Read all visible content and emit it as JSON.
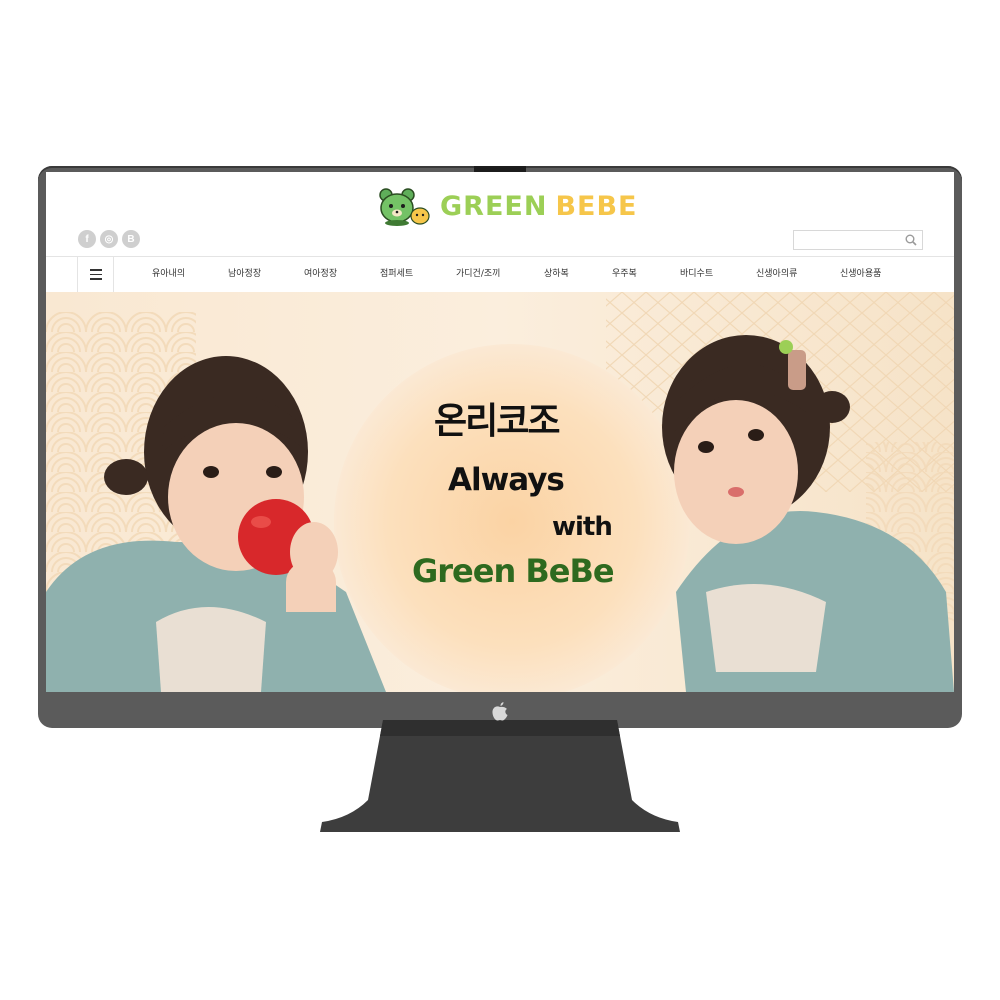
{
  "header": {
    "logo_word_1": "GREEN",
    "logo_word_2": "BEBE"
  },
  "social": [
    {
      "icon": "facebook-icon",
      "glyph": "f"
    },
    {
      "icon": "instagram-icon",
      "glyph": "◎"
    },
    {
      "icon": "blog-icon",
      "glyph": "B"
    }
  ],
  "search": {
    "placeholder": "",
    "icon": "search-icon"
  },
  "nav": {
    "menu_icon": "hamburger-icon",
    "items": [
      {
        "label": "유아내의"
      },
      {
        "label": "남아정장"
      },
      {
        "label": "여아정장"
      },
      {
        "label": "점퍼세트"
      },
      {
        "label": "가디건/조끼"
      },
      {
        "label": "상하복"
      },
      {
        "label": "우주복"
      },
      {
        "label": "바디수트"
      },
      {
        "label": "신생아의류"
      },
      {
        "label": "신생아용품"
      }
    ]
  },
  "hero": {
    "headline_korean": "온리코조",
    "line_1": "Always",
    "line_2": "with",
    "line_3": "Green BeBe"
  },
  "colors": {
    "logo_green": "#9ccf56",
    "logo_yellow": "#f6c64a",
    "brand_dark_green": "#2e6a1f",
    "hero_bg": "#f9e8d2",
    "bezel": "#5b5b5b"
  }
}
